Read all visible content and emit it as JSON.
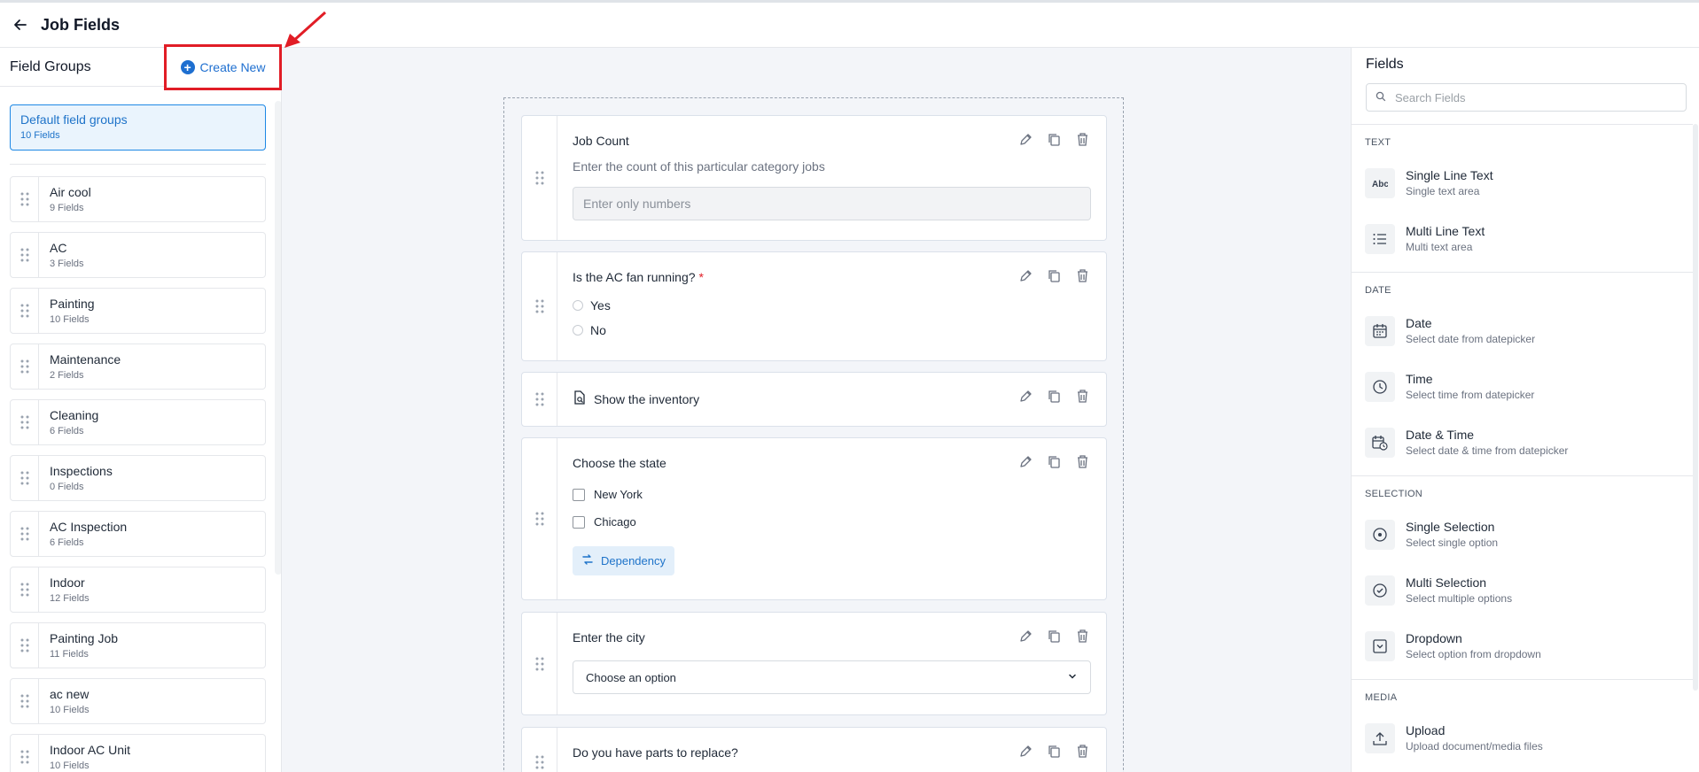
{
  "header": {
    "title": "Job Fields"
  },
  "left": {
    "title": "Field Groups",
    "create_new": "Create New",
    "default_group": {
      "name": "Default field groups",
      "count": "10 Fields"
    },
    "groups": [
      {
        "name": "Air cool",
        "count": "9 Fields"
      },
      {
        "name": "AC",
        "count": "3 Fields"
      },
      {
        "name": "Painting",
        "count": "10 Fields"
      },
      {
        "name": "Maintenance",
        "count": "2 Fields"
      },
      {
        "name": "Cleaning",
        "count": "6 Fields"
      },
      {
        "name": "Inspections",
        "count": "0 Fields"
      },
      {
        "name": "AC Inspection",
        "count": "6 Fields"
      },
      {
        "name": "Indoor",
        "count": "12 Fields"
      },
      {
        "name": "Painting Job",
        "count": "11 Fields"
      },
      {
        "name": "ac new",
        "count": "10 Fields"
      },
      {
        "name": "Indoor AC Unit",
        "count": "10 Fields"
      }
    ]
  },
  "cards": {
    "job_count": {
      "question": "Job Count",
      "description": "Enter the count of this particular category jobs",
      "placeholder": "Enter only numbers"
    },
    "fan": {
      "question": "Is the AC fan running?",
      "required": "*",
      "options": [
        "Yes",
        "No"
      ]
    },
    "inventory": {
      "label": "Show the inventory"
    },
    "state": {
      "question": "Choose the state",
      "options": [
        "New York",
        "Chicago"
      ],
      "dependency": "Dependency"
    },
    "city": {
      "question": "Enter the city",
      "select_value": "Choose an option"
    },
    "parts": {
      "question": "Do you have parts to replace?"
    }
  },
  "right": {
    "title": "Fields",
    "search_placeholder": "Search Fields",
    "sections": {
      "text": {
        "title": "TEXT",
        "items": [
          {
            "name": "Single Line Text",
            "desc": "Single text area",
            "icon": "abc-icon"
          },
          {
            "name": "Multi Line Text",
            "desc": "Multi text area",
            "icon": "list-icon"
          }
        ]
      },
      "date": {
        "title": "DATE",
        "items": [
          {
            "name": "Date",
            "desc": "Select date from datepicker",
            "icon": "calendar-icon"
          },
          {
            "name": "Time",
            "desc": "Select time from datepicker",
            "icon": "clock-icon"
          },
          {
            "name": "Date & Time",
            "desc": "Select date & time from datepicker",
            "icon": "calendar-clock-icon"
          }
        ]
      },
      "selection": {
        "title": "SELECTION",
        "items": [
          {
            "name": "Single Selection",
            "desc": "Select single option",
            "icon": "radio-icon"
          },
          {
            "name": "Multi Selection",
            "desc": "Select multiple options",
            "icon": "check-circle-icon"
          },
          {
            "name": "Dropdown",
            "desc": "Select option from dropdown",
            "icon": "dropdown-icon"
          }
        ]
      },
      "media": {
        "title": "MEDIA",
        "items": [
          {
            "name": "Upload",
            "desc": "Upload document/media files",
            "icon": "upload-icon"
          }
        ]
      }
    }
  },
  "colors": {
    "accent": "#1e6fd0",
    "highlight": "#e11d26",
    "canvas": "#f3f5f9"
  }
}
